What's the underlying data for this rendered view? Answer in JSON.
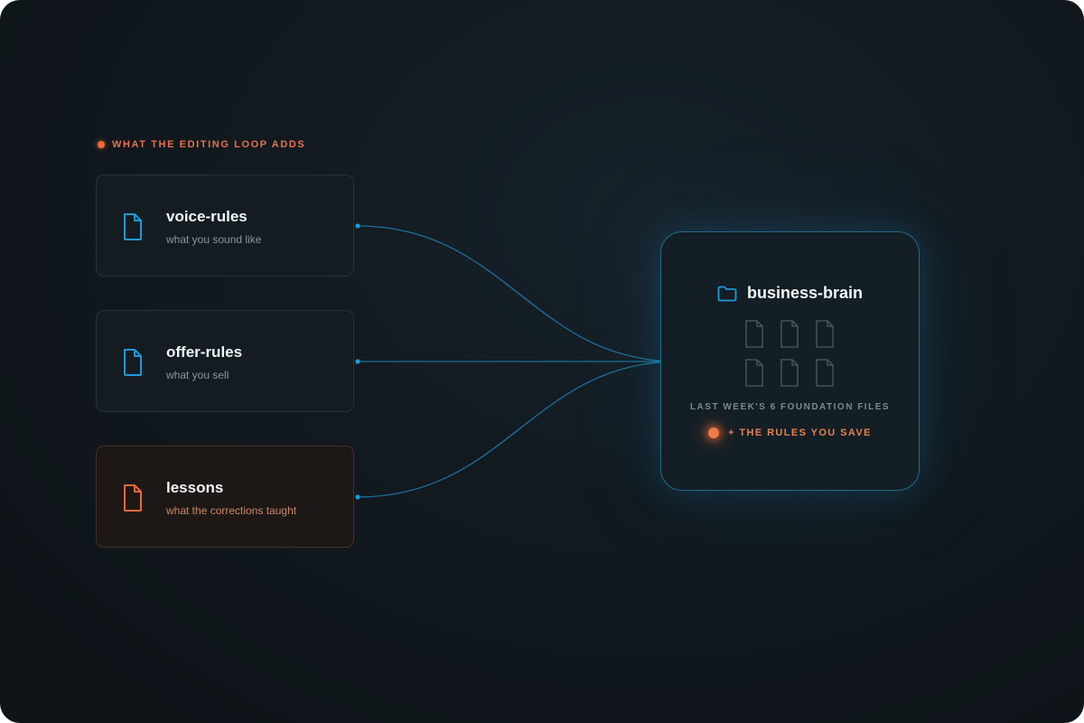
{
  "section_label": "WHAT THE EDITING LOOP ADDS",
  "colors": {
    "accent_blue": "#1e9ad6",
    "accent_orange": "#ee6a3a",
    "connector": "#1f7fae"
  },
  "sources": [
    {
      "title": "voice-rules",
      "subtitle": "what you sound like",
      "icon": "file-icon",
      "tone": "blue"
    },
    {
      "title": "offer-rules",
      "subtitle": "what you sell",
      "icon": "file-icon",
      "tone": "blue"
    },
    {
      "title": "lessons",
      "subtitle": "what the corrections taught",
      "icon": "file-icon",
      "tone": "orange"
    }
  ],
  "target": {
    "title": "business-brain",
    "icon": "folder-icon",
    "file_count": 6,
    "caption": "LAST WEEK'S 6 FOUNDATION FILES",
    "addition": "+ THE RULES YOU SAVE"
  }
}
